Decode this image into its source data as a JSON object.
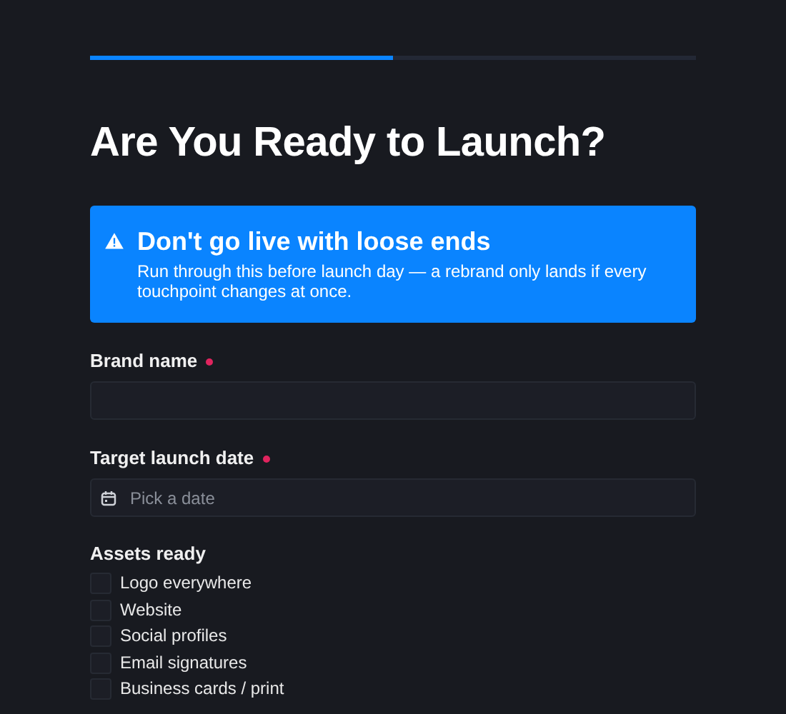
{
  "progress": {
    "level": 0.5
  },
  "title": "Are You Ready to Launch?",
  "alert": {
    "title": "Don't go live with loose ends",
    "body": "Run through this before launch day — a rebrand only lands if every touchpoint changes at once."
  },
  "fields": [
    {
      "label": "Brand name",
      "required": true,
      "kind": "text"
    },
    {
      "label": "Target launch date",
      "required": true,
      "kind": "date",
      "placeholder": "Pick a date"
    }
  ],
  "assets": {
    "label": "Assets ready",
    "items": [
      {
        "label": "Logo everywhere",
        "checked": false
      },
      {
        "label": "Website",
        "checked": false
      },
      {
        "label": "Social profiles",
        "checked": false
      },
      {
        "label": "Email signatures",
        "checked": false
      },
      {
        "label": "Business cards / print",
        "checked": false
      }
    ]
  }
}
